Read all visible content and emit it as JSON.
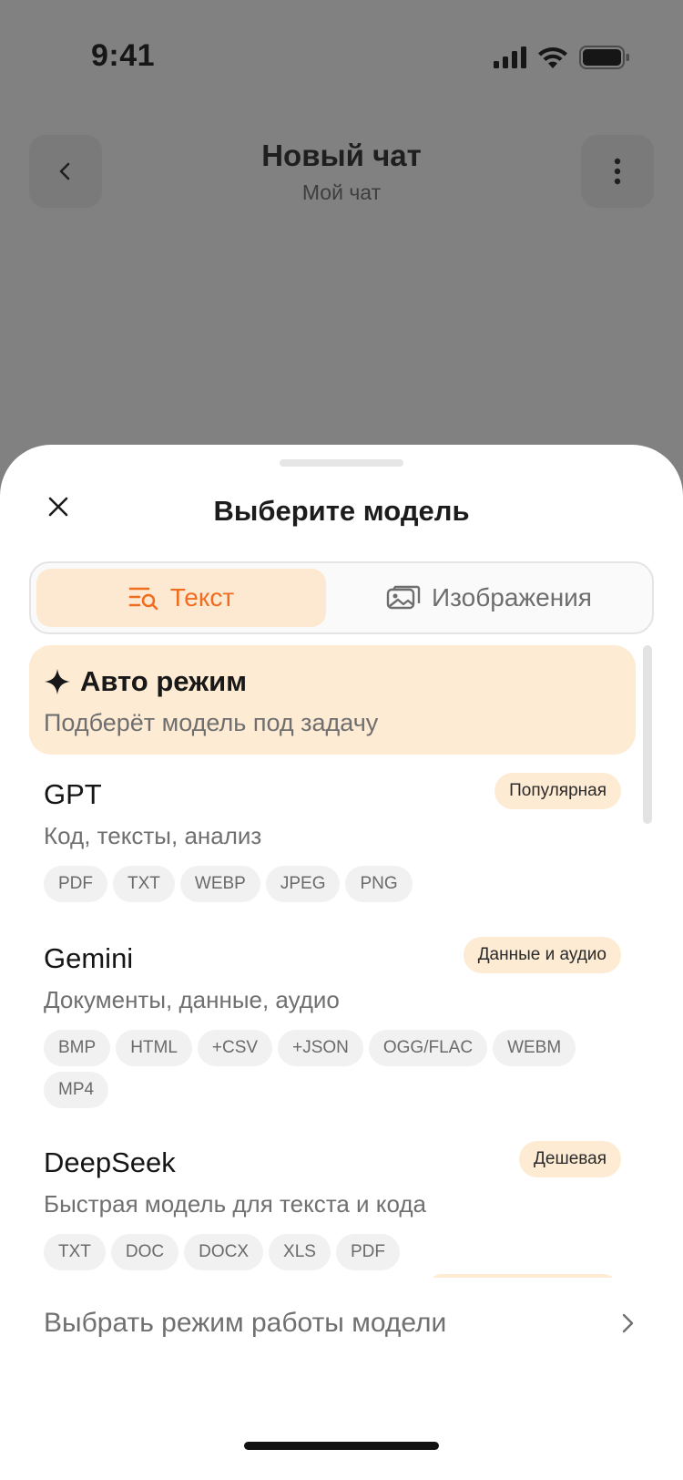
{
  "status": {
    "time": "9:41"
  },
  "nav": {
    "back_icon": "chevron-left-icon",
    "title": "Новый чат",
    "subtitle": "Мой чат",
    "more_icon": "more-vertical-icon"
  },
  "sheet": {
    "title": "Выберите модель",
    "close_icon": "close-icon",
    "tabs": [
      {
        "label": "Текст",
        "icon": "text-search-icon",
        "selected": true
      },
      {
        "label": "Изображения",
        "icon": "images-icon",
        "selected": false
      }
    ],
    "auto": {
      "icon": "sparkle-icon",
      "title": "Авто режим",
      "subtitle": "Подберёт модель под задачу"
    },
    "models": [
      {
        "name": "GPT",
        "description": "Код, тексты, анализ",
        "badge": "Популярная",
        "tags": [
          "PDF",
          "TXT",
          "WEBP",
          "JPEG",
          "PNG"
        ]
      },
      {
        "name": "Gemini",
        "description": "Документы, данные, аудио",
        "badge": "Данные и аудио",
        "tags": [
          "BMP",
          "HTML",
          "+CSV",
          "+JSON",
          "OGG/FLAC",
          "WEBM",
          "MP4"
        ]
      },
      {
        "name": "DeepSeek",
        "description": "Быстрая модель для текста и кода",
        "badge": "Дешевая",
        "tags": [
          "TXT",
          "DOC",
          "DOCX",
          "XLS",
          "PDF"
        ]
      }
    ],
    "mode_row": {
      "label": "Выбрать режим работы модели",
      "icon": "chevron-right-icon"
    }
  },
  "colors": {
    "accent": "#f06d1f",
    "accent_bg": "#feebd4",
    "overlay": "#818181"
  }
}
